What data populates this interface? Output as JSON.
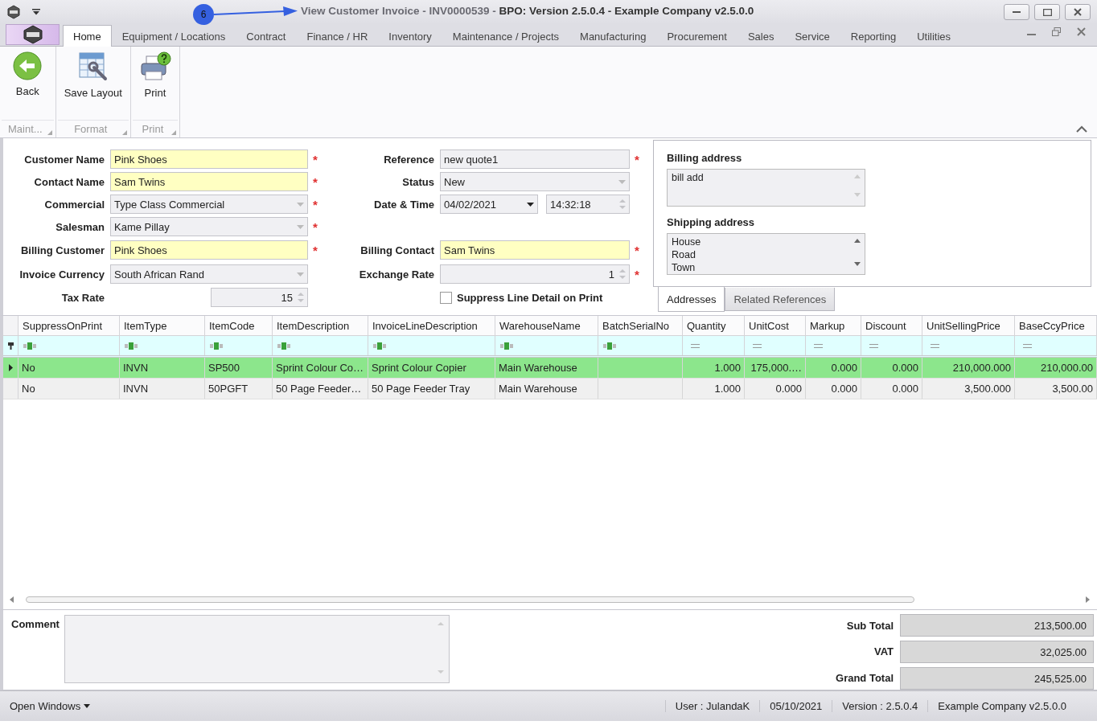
{
  "window": {
    "title": "View Customer Invoice - INV0000539 - **BPO: Version 2.5.0.4 - Example Company v2.5.0.0**"
  },
  "annotation": {
    "step": "6"
  },
  "ribbon_tabs": [
    {
      "label": "Home",
      "selected": true
    },
    {
      "label": "Equipment / Locations",
      "selected": false
    },
    {
      "label": "Contract",
      "selected": false
    },
    {
      "label": "Finance / HR",
      "selected": false
    },
    {
      "label": "Inventory",
      "selected": false
    },
    {
      "label": "Maintenance / Projects",
      "selected": false
    },
    {
      "label": "Manufacturing",
      "selected": false
    },
    {
      "label": "Procurement",
      "selected": false
    },
    {
      "label": "Sales",
      "selected": false
    },
    {
      "label": "Service",
      "selected": false
    },
    {
      "label": "Reporting",
      "selected": false
    },
    {
      "label": "Utilities",
      "selected": false
    }
  ],
  "ribbon_groups": [
    {
      "caption": "Maint...",
      "buttons": [
        {
          "label": "Back",
          "kind": "back"
        }
      ]
    },
    {
      "caption": "Format",
      "buttons": [
        {
          "label": "Save Layout",
          "kind": "layout"
        }
      ]
    },
    {
      "caption": "Print",
      "buttons": [
        {
          "label": "Print",
          "kind": "print"
        }
      ]
    }
  ],
  "form_rows": [
    {
      "left": {
        "label": "Customer Name",
        "kind": "text",
        "value": "Pink Shoes",
        "highlighted": true,
        "required_mark": "*"
      },
      "right": {
        "label": "Reference",
        "kind": "text",
        "value": "new quote1",
        "highlighted": false,
        "required_mark": "*"
      }
    },
    {
      "left": {
        "label": "Contact Name",
        "kind": "text",
        "value": "Sam Twins",
        "highlighted": true,
        "required_mark": "*"
      },
      "right": {
        "label": "Status",
        "kind": "combo",
        "value": "New",
        "highlighted": false
      }
    },
    {
      "left": {
        "label": "Commercial",
        "kind": "combo",
        "value": "Type Class Commercial",
        "highlighted": false,
        "required_mark": "*"
      },
      "right": {
        "label": "Date & Time",
        "kind": "datetime",
        "value": "04/02/2021",
        "time": "14:32:18",
        "highlighted": false
      }
    },
    {
      "left": {
        "label": "Salesman",
        "kind": "combo",
        "value": "Kame Pillay",
        "highlighted": false,
        "required_mark": "*"
      }
    },
    {
      "left": {
        "label": "Billing Customer",
        "kind": "text",
        "value": "Pink Shoes",
        "highlighted": true,
        "required_mark": "*"
      },
      "right": {
        "label": "Billing Contact",
        "kind": "text",
        "value": "Sam Twins",
        "highlighted": true,
        "required_mark": "*"
      }
    },
    {
      "left": {
        "label": "Invoice Currency",
        "kind": "combo",
        "value": "South African Rand",
        "highlighted": false
      },
      "right": {
        "label": "Exchange Rate",
        "kind": "spin",
        "value": "1",
        "highlighted": false,
        "required_mark": "*"
      }
    },
    {
      "left": {
        "label": "Tax Rate",
        "kind": "spin_short",
        "value": "15",
        "highlighted": false
      },
      "right": {
        "label": "Suppress Line Detail on Print",
        "kind": "checkbox",
        "checked": false
      }
    }
  ],
  "addresses": [
    {
      "label": "Billing address",
      "lines": [
        "bill add"
      ]
    },
    {
      "label": "Shipping address",
      "lines": [
        "House",
        "Road",
        "Town"
      ]
    }
  ],
  "address_tabs": [
    {
      "label": "Addresses",
      "selected": true
    },
    {
      "label": "Related References",
      "selected": false
    }
  ],
  "table": {
    "columns": [
      {
        "label": "SuppressOnPrint",
        "kind": "text"
      },
      {
        "label": "ItemType",
        "kind": "text"
      },
      {
        "label": "ItemCode",
        "kind": "text"
      },
      {
        "label": "ItemDescription",
        "kind": "text"
      },
      {
        "label": "InvoiceLineDescription",
        "kind": "text"
      },
      {
        "label": "WarehouseName",
        "kind": "text"
      },
      {
        "label": "BatchSerialNo",
        "kind": "text"
      },
      {
        "label": "Quantity",
        "kind": "number"
      },
      {
        "label": "UnitCost",
        "kind": "number"
      },
      {
        "label": "Markup",
        "kind": "number"
      },
      {
        "label": "Discount",
        "kind": "number"
      },
      {
        "label": "UnitSellingPrice",
        "kind": "number"
      },
      {
        "label": "BaseCcyPrice",
        "kind": "number"
      }
    ],
    "rows": [
      {
        "selected": true,
        "cells": [
          "No",
          "INVN",
          "SP500",
          "Sprint Colour Co…",
          "Sprint Colour Copier",
          "Main Warehouse",
          "",
          "1.000",
          "175,000.…",
          "0.000",
          "0.000",
          "210,000.000",
          "210,000.00"
        ]
      },
      {
        "selected": false,
        "cells": [
          "No",
          "INVN",
          "50PGFT",
          "50 Page Feeder…",
          "50 Page Feeder Tray",
          "Main Warehouse",
          "",
          "1.000",
          "0.000",
          "0.000",
          "0.000",
          "3,500.000",
          "3,500.00"
        ]
      }
    ]
  },
  "comment": {
    "label": "Comment"
  },
  "totals": [
    {
      "label": "Sub Total",
      "value": "213,500.00"
    },
    {
      "label": "VAT",
      "value": "32,025.00"
    },
    {
      "label": "Grand Total",
      "value": "245,525.00"
    }
  ],
  "status_bar": {
    "open_windows": "Open Windows",
    "items": [
      "User : JulandaK",
      "05/10/2021",
      "Version : 2.5.0.4",
      "Example Company v2.5.0.0"
    ]
  }
}
